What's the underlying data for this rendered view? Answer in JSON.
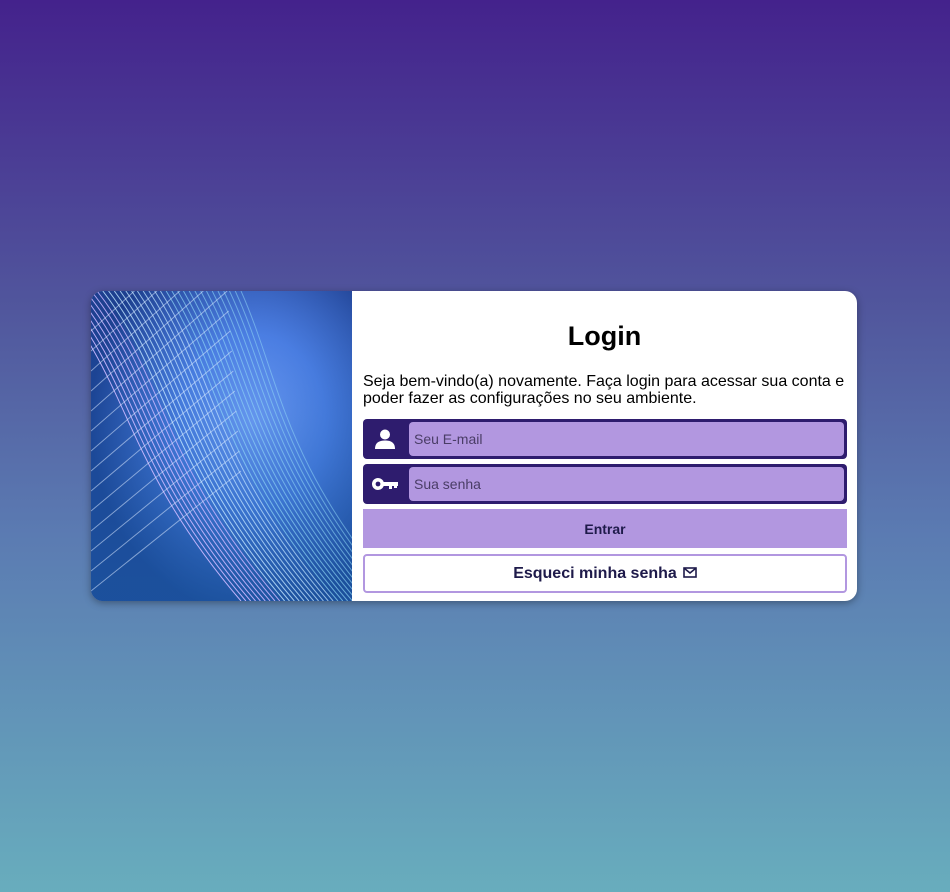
{
  "login": {
    "title": "Login",
    "welcome_text": "Seja bem-vindo(a) novamente. Faça login para acessar sua conta e poder fazer as configurações no seu ambiente.",
    "email_placeholder": "Seu E-mail",
    "password_placeholder": "Sua senha",
    "submit_label": "Entrar",
    "forgot_label": "Esqueci minha senha",
    "icons": {
      "email_field": "user-icon",
      "password_field": "key-icon",
      "forgot_button": "envelope-icon"
    }
  },
  "colors": {
    "accent": "#b297e0",
    "icon_bg": "#2e1c6e",
    "text_dark": "#1e1a4a"
  }
}
